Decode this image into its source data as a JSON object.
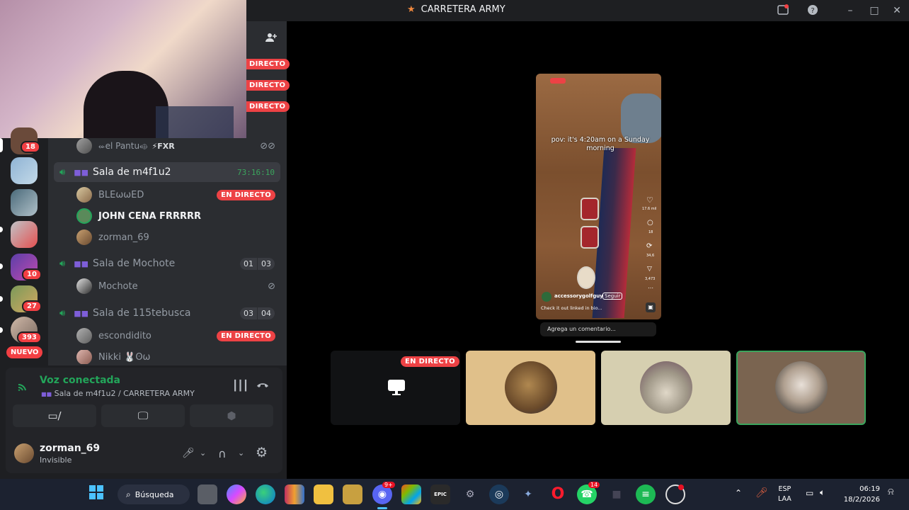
{
  "window": {
    "title": "CARRETERA ARMY",
    "title_icon": "flame-icon",
    "controls": [
      "inbox-icon",
      "help-icon",
      "minimize-icon",
      "maximize-icon",
      "close-icon"
    ]
  },
  "stream_badges": [
    "DIRECTO",
    "DIRECTO",
    "DIRECTO"
  ],
  "top_channel_user": {
    "name": "⬰el Pantu⬲",
    "tag": "⚡FXR"
  },
  "rooms": [
    {
      "name": "Sala de m4f1u2",
      "timer": "73:16:10",
      "members": [
        {
          "name": "BLEωωED",
          "badge": "EN DIRECTO"
        },
        {
          "name": "JOHN CENA FRRRRR",
          "badge": ""
        },
        {
          "name": "zorman_69",
          "badge": ""
        }
      ]
    },
    {
      "name": "Sala de Mochote",
      "count_a": "01",
      "count_b": "03",
      "members": [
        {
          "name": "Mochote",
          "badge": ""
        }
      ]
    },
    {
      "name": "Sala de 115tebusca",
      "count_a": "03",
      "count_b": "04",
      "members": [
        {
          "name": "escondidito",
          "badge": "EN DIRECTO"
        },
        {
          "name": "Nikki 🐰ʘω",
          "badge": ""
        }
      ]
    }
  ],
  "server_badges": [
    "18",
    "10",
    "27",
    "393"
  ],
  "nuevo_label": "NUEVO",
  "voice": {
    "status": "Voz conectada",
    "location": "Sala de m4f1u2 / CARRETERA ARMY"
  },
  "user": {
    "name": "zorman_69",
    "status": "Invisible"
  },
  "stream": {
    "caption": "pov: it's 4:20am on a Sunday morning",
    "account": "accessorygolfguy",
    "follow": "Seguir",
    "desc": "Check it out linked in bio...",
    "comment_placeholder": "Agrega un comentario...",
    "likes": "17.6 mil",
    "comments": "18",
    "reposts": "34,6",
    "shares": "3,473"
  },
  "tiles": [
    {
      "badge": "EN DIRECTO",
      "type": "screen-share",
      "color": "#111214"
    },
    {
      "badge": "",
      "type": "avatar",
      "color": "#e0c08a"
    },
    {
      "badge": "",
      "type": "avatar",
      "color": "#d6cfb0"
    },
    {
      "badge": "",
      "type": "avatar",
      "color": "#7a6450",
      "speaking": true
    }
  ],
  "taskbar": {
    "search_label": "Búsqueda",
    "discord_badge": "9+",
    "whatsapp_badge": "14",
    "lang_top": "ESP",
    "lang_bottom": "LAA",
    "time": "06:19",
    "date": "18/2/2026"
  },
  "colors": {
    "accent_green": "#23a55a",
    "live_red": "#ed4245",
    "speaking_border": "#3ba55d"
  }
}
